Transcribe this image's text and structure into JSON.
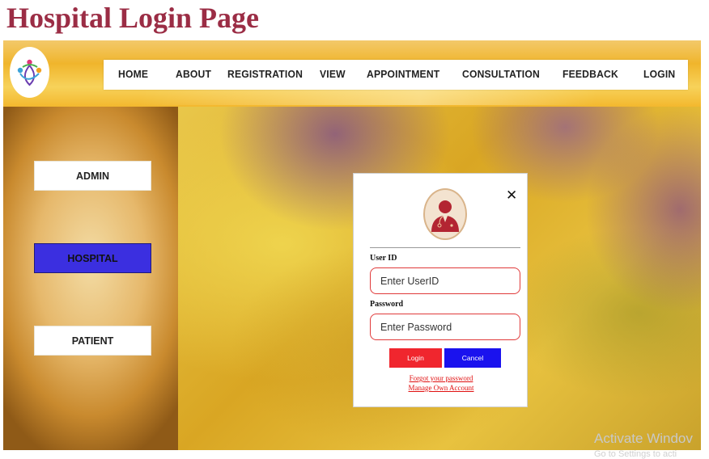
{
  "page": {
    "heading": "Hospital Login Page"
  },
  "header": {
    "logo_icon": "hospital-logo-icon",
    "nav": [
      {
        "label": "HOME"
      },
      {
        "label": "ABOUT"
      },
      {
        "label": "REGISTRATION"
      },
      {
        "label": "VIEW"
      },
      {
        "label": "APPOINTMENT"
      },
      {
        "label": "CONSULTATION"
      },
      {
        "label": "FEEDBACK"
      },
      {
        "label": "LOGIN"
      }
    ]
  },
  "sidebar": {
    "items": [
      {
        "label": "ADMIN",
        "active": false
      },
      {
        "label": "HOSPITAL",
        "active": true
      },
      {
        "label": "PATIENT",
        "active": false
      }
    ],
    "active_color": "#3b2fe0"
  },
  "login_modal": {
    "close_icon": "close-icon",
    "avatar_icon": "doctor-avatar-icon",
    "userid_label": "User ID",
    "userid_placeholder": "Enter UserID",
    "password_label": "Password",
    "password_placeholder": "Enter Password",
    "login_button": "Login",
    "cancel_button": "Cancel",
    "forgot_link": "Forgot your password",
    "manage_link": "Manage Own Account",
    "colors": {
      "login": "#f0262e",
      "cancel": "#1a12ee",
      "border": "#e03a3a"
    }
  },
  "os_watermark": {
    "line1": "Activate Windov",
    "line2": "Go to Settings to acti"
  }
}
